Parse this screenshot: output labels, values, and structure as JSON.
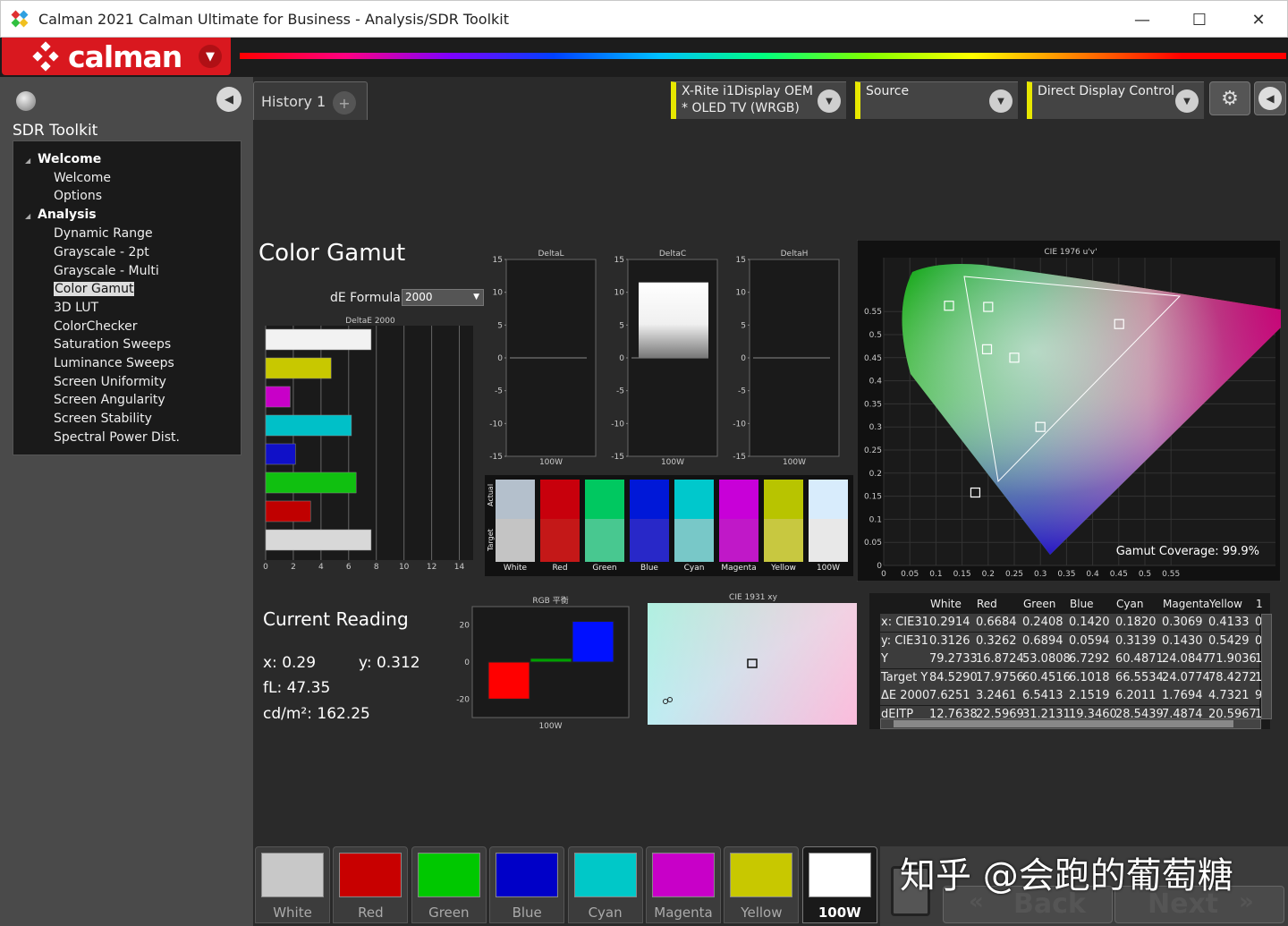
{
  "window": {
    "title": "Calman 2021 Calman Ultimate for Business  - Analysis/SDR Toolkit",
    "minimize": "—",
    "maximize": "☐",
    "close": "✕"
  },
  "brand": {
    "logo_text": "calman"
  },
  "left_panel": {
    "title": "SDR Toolkit",
    "items": [
      {
        "label": "Welcome",
        "type": "header"
      },
      {
        "label": "Welcome",
        "type": "item"
      },
      {
        "label": "Options",
        "type": "item"
      },
      {
        "label": "Analysis",
        "type": "header"
      },
      {
        "label": "Dynamic Range",
        "type": "item"
      },
      {
        "label": "Grayscale - 2pt",
        "type": "item"
      },
      {
        "label": "Grayscale - Multi",
        "type": "item"
      },
      {
        "label": "Color Gamut",
        "type": "item",
        "selected": true
      },
      {
        "label": "3D LUT",
        "type": "item"
      },
      {
        "label": "ColorChecker",
        "type": "item"
      },
      {
        "label": "Saturation Sweeps",
        "type": "item"
      },
      {
        "label": "Luminance Sweeps",
        "type": "item"
      },
      {
        "label": "Screen Uniformity",
        "type": "item"
      },
      {
        "label": "Screen Angularity",
        "type": "item"
      },
      {
        "label": "Screen Stability",
        "type": "item"
      },
      {
        "label": "Spectral Power Dist.",
        "type": "item"
      }
    ]
  },
  "tabs": {
    "history": "History 1",
    "add": "+"
  },
  "devices": {
    "meter_line1": "X-Rite i1Display OEM",
    "meter_line2": "* OLED TV (WRGB)",
    "source": "Source",
    "display": "Direct Display Control"
  },
  "section": {
    "title": "Color Gamut",
    "de_formula_label": "dE Formula:",
    "de_formula_value": "2000"
  },
  "current_reading": {
    "title": "Current Reading",
    "x": "x: 0.29",
    "y": "y: 0.312",
    "fl": "fL: 47.35",
    "cdm2": "cd/m²: 162.25"
  },
  "chart_data": [
    {
      "type": "bar",
      "title": "DeltaE 2000",
      "orientation": "horizontal",
      "categories": [
        "White",
        "Yellow",
        "Magenta",
        "Cyan",
        "Blue",
        "Green",
        "Red",
        "100W"
      ],
      "values": [
        7.6251,
        4.7321,
        1.7694,
        6.2011,
        2.1519,
        6.5413,
        3.2461,
        7.6251
      ],
      "colors": [
        "#f2f2f2",
        "#c8c800",
        "#c800c8",
        "#00c0c8",
        "#1010c8",
        "#10c010",
        "#c00000",
        "#d8d8d8"
      ],
      "xlim": [
        0,
        15
      ],
      "xticks": [
        "0",
        "2",
        "4",
        "6",
        "8",
        "10",
        "12",
        "14"
      ]
    },
    {
      "type": "bar",
      "title": "DeltaL",
      "categories": [
        "100W"
      ],
      "values": [
        0
      ],
      "ylim": [
        -15,
        15
      ],
      "yticks": [
        "15",
        "10",
        "5",
        "0",
        "-5",
        "-10",
        "-15"
      ]
    },
    {
      "type": "bar",
      "title": "DeltaC",
      "categories": [
        "100W"
      ],
      "values": [
        11.5
      ],
      "ylim": [
        -15,
        15
      ],
      "yticks": [
        "15",
        "10",
        "5",
        "0",
        "-5",
        "-10",
        "-15"
      ]
    },
    {
      "type": "bar",
      "title": "DeltaH",
      "categories": [
        "100W"
      ],
      "values": [
        0
      ],
      "ylim": [
        -15,
        15
      ],
      "yticks": [
        "15",
        "10",
        "5",
        "0",
        "-5",
        "-10",
        "-15"
      ]
    },
    {
      "type": "bar",
      "title": "RGB 平衡",
      "categories": [
        "100W"
      ],
      "series": [
        {
          "name": "R",
          "values": [
            -20
          ]
        },
        {
          "name": "G",
          "values": [
            2
          ]
        },
        {
          "name": "B",
          "values": [
            22
          ]
        }
      ],
      "ylim": [
        -30,
        30
      ],
      "yticks": [
        "20",
        "0",
        "-20"
      ]
    },
    {
      "type": "scatter",
      "title": "CIE 1976 u'v'",
      "xticks": [
        "0",
        "0.05",
        "0.1",
        "0.15",
        "0.2",
        "0.25",
        "0.3",
        "0.35",
        "0.4",
        "0.45",
        "0.5",
        "0.55"
      ],
      "yticks": [
        "0",
        "0.05",
        "0.1",
        "0.15",
        "0.2",
        "0.25",
        "0.3",
        "0.35",
        "0.4",
        "0.45",
        "0.5",
        "0.55"
      ],
      "xlim": [
        0,
        0.6
      ],
      "ylim": [
        0,
        0.6
      ],
      "targets": [
        [
          0.4507,
          0.5229
        ],
        [
          0.125,
          0.5625
        ],
        [
          0.1754,
          0.1579
        ],
        [
          0.1978,
          0.4683
        ],
        [
          0.3,
          0.3
        ],
        [
          0.25,
          0.45
        ],
        [
          0.2,
          0.56
        ]
      ],
      "annotation": "Gamut Coverage:  99.9%"
    },
    {
      "type": "scatter",
      "title": "CIE 1931 xy"
    }
  ],
  "swatches": {
    "actual_label": "Actual",
    "target_label": "Target",
    "items": [
      {
        "name": "White",
        "actual": "#b4c0cc",
        "target": "#c4c4c4"
      },
      {
        "name": "Red",
        "actual": "#c8000c",
        "target": "#c41818"
      },
      {
        "name": "Green",
        "actual": "#00c860",
        "target": "#48c890"
      },
      {
        "name": "Blue",
        "actual": "#0018d8",
        "target": "#2828c8"
      },
      {
        "name": "Cyan",
        "actual": "#00c8cc",
        "target": "#78c8c8"
      },
      {
        "name": "Magenta",
        "actual": "#c800d8",
        "target": "#c018c8"
      },
      {
        "name": "Yellow",
        "actual": "#b8c400",
        "target": "#c8c840"
      },
      {
        "name": "100W",
        "actual": "#d8ecfc",
        "target": "#e8e8e8"
      }
    ]
  },
  "table": {
    "headers": [
      "White",
      "Red",
      "Green",
      "Blue",
      "Cyan",
      "Magenta",
      "Yellow",
      "1"
    ],
    "rows": [
      {
        "label": "x: CIE31",
        "values": [
          "0.2914",
          "0.6684",
          "0.2408",
          "0.1420",
          "0.1820",
          "0.3069",
          "0.4133",
          "0"
        ]
      },
      {
        "label": "y: CIE31",
        "values": [
          "0.3126",
          "0.3262",
          "0.6894",
          "0.0594",
          "0.3139",
          "0.1430",
          "0.5429",
          "0"
        ]
      },
      {
        "label": "Y",
        "values": [
          "79.2733",
          "16.8724",
          "53.0808",
          "6.7292",
          "60.4871",
          "24.0847",
          "71.9036",
          "1"
        ]
      },
      {
        "label": "Target Y",
        "values": [
          "84.5290",
          "17.9756",
          "60.4516",
          "6.1018",
          "66.5534",
          "24.0774",
          "78.4272",
          "1"
        ]
      },
      {
        "label": "ΔE 2000",
        "values": [
          "7.6251",
          "3.2461",
          "6.5413",
          "2.1519",
          "6.2011",
          "1.7694",
          "4.7321",
          "9"
        ]
      },
      {
        "label": "dEITP",
        "values": [
          "12.7638",
          "22.5969",
          "31.2131",
          "19.3460",
          "28.5439",
          "7.4874",
          "20.5967",
          "1"
        ]
      }
    ]
  },
  "patches": [
    {
      "name": "White",
      "color": "#c8c8c8"
    },
    {
      "name": "Red",
      "color": "#c80000"
    },
    {
      "name": "Green",
      "color": "#00c800"
    },
    {
      "name": "Blue",
      "color": "#0000c8"
    },
    {
      "name": "Cyan",
      "color": "#00c8c8"
    },
    {
      "name": "Magenta",
      "color": "#c800c8"
    },
    {
      "name": "Yellow",
      "color": "#c8c800"
    },
    {
      "name": "100W",
      "color": "#ffffff",
      "active": true
    }
  ],
  "nav": {
    "back": "Back",
    "next": "Next",
    "back_glyph": "«",
    "next_glyph": "»"
  },
  "watermark": "知乎 @会跑的葡萄糖"
}
